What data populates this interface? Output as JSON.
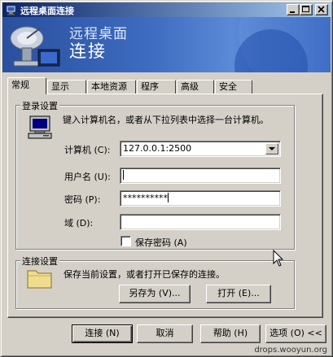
{
  "window": {
    "title": "远程桌面连接",
    "banner_line1": "远程桌面",
    "banner_line2": "连接"
  },
  "tabs": [
    "常规",
    "显示",
    "本地资源",
    "程序",
    "高级",
    "安全"
  ],
  "active_tab": "常规",
  "login_group": {
    "title": "登录设置",
    "description": "键入计算机名，或者从下拉列表中选择一台计算机。",
    "computer_label": "计算机 (C):",
    "computer_value": "127.0.0.1:2500",
    "username_label": "用户名 (U):",
    "username_value": "",
    "password_label": "密码 (P):",
    "password_value": "**********",
    "domain_label": "域 (D):",
    "domain_value": "",
    "save_password_label": "保存密码 (A)",
    "save_password_checked": false
  },
  "connection_group": {
    "title": "连接设置",
    "description": "保存当前设置，或者打开已保存的连接。",
    "save_as_label": "另存为 (V)...",
    "open_label": "打开 (E)..."
  },
  "buttons": {
    "connect": "连接 (N)",
    "cancel": "取消",
    "help": "帮助 (H)",
    "options": "选项 (O) <<"
  },
  "watermark": "drops.wooyun.org",
  "colors": {
    "titlebar_start": "#0a246a",
    "titlebar_end": "#a6caf0",
    "banner": "#3d6cc0",
    "face": "#d4d0c8"
  }
}
